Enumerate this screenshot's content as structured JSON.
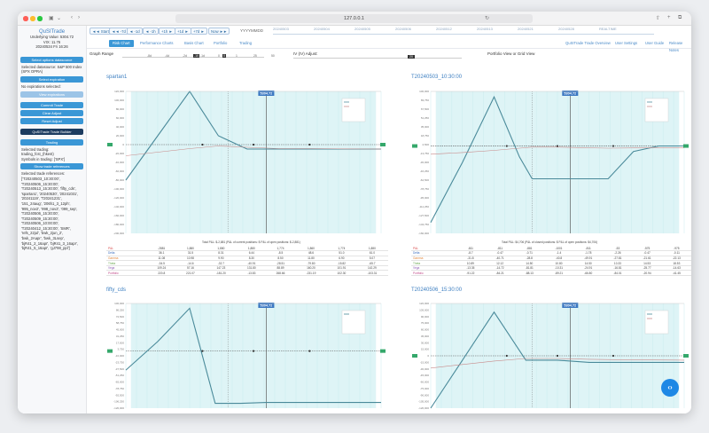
{
  "window": {
    "url": "127.0.0.1",
    "traffic_colors": [
      "#fe5f57",
      "#febc2e",
      "#28c840"
    ]
  },
  "sidebar": {
    "app_title": "QuSITrade",
    "underlying_label": "Underlying Value:",
    "underlying_value": "5304.72",
    "vix_label": "VIX:",
    "vix_value": "11.76",
    "date_label": "20240534 Fri",
    "time_value": "16:26",
    "btn_select_underlying": "Select options datasource",
    "selected_ds": "Selected datasource: S&P 500 Index (SPX OPRA)",
    "btn_select_expiration": "Select expiration",
    "no_expiration": "No expirations selected:",
    "btn_view_expiration": "View expirations",
    "btn_commit": "Commit Trade",
    "btn_clear": "Clear Adjust",
    "btn_reset": "Reset Adjust",
    "btn_builder": "QuSITrade Trade Builder",
    "trading_header": "Trading",
    "selected_trading": "Selected trading:",
    "trading_value": "trading_fcst_(hkest)",
    "symbols_label": "Symbols in trading: ['SPX']",
    "btn_show_refs": "Show trade references",
    "selected_refs_label": "Selected trade references:",
    "refs": [
      "['T20240503_10:30:00',",
      "'T20240506_15:30:00',",
      "'T20240513_15:30:00', 'fifty_cds',",
      "'spartan1', '20240530', '20241031',",
      "'20241119', 'T20241231',",
      "'151_24aug', '206h1_3_12ph',",
      "'995_nov2', '998_nov2', '099_sep',",
      "'T20240506_15:30:00',",
      "'T20240509_15:30:00',",
      "'T20240506_10:00:00',",
      "'T20240412_15:30:00', 'SMR',",
      "'refs_22jul', 'bwk_2jun_2',",
      "'bwk_2Aapr', 'bwk_3Lsep',",
      "'bjR41_2_16apr', 'bjR41_3_16apr',",
      "'bjR41_5_16apr', 'gJ798_ppl']"
    ]
  },
  "nav": {
    "buttons": [
      "◄◄ Start",
      "◄◄ -7d",
      "◄ -1d",
      "◄ -1h",
      "+1h ►",
      "+1d ►",
      "+7d ►",
      "Now ►►"
    ],
    "date_placeholder": "YYYYMMDD",
    "timeline": [
      "20240503",
      "20240504",
      "20240505",
      "20240506",
      "20240512",
      "20240513",
      "20240521",
      "20240528",
      "REALTIME"
    ]
  },
  "tabs": {
    "items": [
      "Risk Chart",
      "Performance Charts",
      "Basis Chart",
      "Portfolio",
      "Trading"
    ],
    "right_items": [
      "QuSITrade Trade Overview",
      "User Settings",
      "User Guide",
      "Release Notes"
    ]
  },
  "controls": {
    "graph_range_label": "Graph Range",
    "graph_ticks": [
      "-8d",
      "-4d",
      "-2d",
      "-1d",
      "0",
      "1",
      "25",
      "50"
    ],
    "graph_handles": [
      "-10",
      "0"
    ],
    "iv_label": "IV (IV) Adjust:",
    "iv_value": "20",
    "portfolio_label": "Portfolio View or Grid View"
  },
  "panels": [
    {
      "title": "spartan1",
      "price": "5304.72",
      "summary": "Total P&L: $-2,881 (P&L of current positions: $ P&L of open positions: $-2,881)"
    },
    {
      "title": "T20240503_10:30:00",
      "price": "5304.72",
      "summary": "Total P&L: $4,706 (P&L of closed positions: $ P&L of open positions: $4,706)"
    },
    {
      "title": "fifty_cds",
      "price": "5304.72"
    },
    {
      "title": "T20240506_15:30:00",
      "price": "5304.72"
    }
  ],
  "tables": {
    "left": {
      "labels": [
        "P&L",
        "Delta",
        "Gamma",
        "Theta",
        "Vega",
        "Portfolio"
      ],
      "rows": [
        [
          "-2881",
          "1,880",
          "1,880",
          "1,880",
          "1,774",
          "1,860",
          "1,774",
          "1,880"
        ],
        [
          "36.1",
          "31.5",
          "8.31",
          "6.44",
          "-8.5",
          "48.6",
          "51.0",
          "61.0"
        ],
        [
          "11.08",
          "10.98",
          "9.90",
          "8.30",
          "8.50",
          "11.80",
          "6.90",
          "5.07"
        ],
        [
          "-34.5",
          "-14.6",
          "-32.7",
          "-40.91",
          "-28.51",
          "-79.80",
          "-15.82",
          "-65.7"
        ],
        [
          "109.24",
          "57.16",
          "147.23",
          "131.80",
          "88.89",
          "160.20",
          "101.91",
          "142.29"
        ],
        [
          "220.8",
          "221.07",
          "-181.20",
          "-13.83",
          "268.66",
          "-231.19",
          "102.30",
          "-103.31"
        ]
      ]
    },
    "right": {
      "labels": [
        "P&L",
        "Delta",
        "Gamma",
        "Theta",
        "Vega",
        "Portfolio"
      ],
      "rows": [
        [
          "-811",
          "-811",
          "-881",
          "-1001",
          "-811",
          "-53",
          "-575",
          "-975"
        ],
        [
          "-8.7",
          "-0.47",
          "-0.71",
          "-1.4",
          "-1.78",
          "-2.26",
          "-0.47",
          "-0.11"
        ],
        [
          "-31.8",
          "-40.71",
          "-28.8",
          "-40.8",
          "-49.91",
          "-27.81",
          "-21.61",
          "-22.13"
        ],
        [
          "10.89",
          "12.12",
          "14.50",
          "10.80",
          "14.50",
          "10.33",
          "14.53",
          "18.53"
        ],
        [
          "-13.35",
          "-14.72",
          "-81.81",
          "-10.31",
          "-24.91",
          "-16.81",
          "-25.77",
          "-14.63"
        ],
        [
          "-91.22",
          "-84.21",
          "-88.13",
          "-89.21",
          "-66.80",
          "-84.01",
          "-20.94",
          "-41.45"
        ]
      ]
    }
  },
  "chart_data": [
    {
      "type": "line",
      "title": "spartan1",
      "x": [
        4400,
        4650,
        4900,
        5125,
        5350,
        5600,
        5850,
        6100,
        6400
      ],
      "y_ylim": [
        -200000,
        120000
      ],
      "ylim": [
        -200000,
        120000
      ],
      "series": [
        {
          "name": "Expiration",
          "values": [
            -80000,
            20000,
            120000,
            20000,
            -10000,
            -10000,
            -10000,
            -10000,
            -10000
          ]
        },
        {
          "name": "T+0",
          "values": [
            -25000,
            -17000,
            -9000,
            -3000,
            -6000,
            -9000,
            -9000,
            -9500,
            -10000
          ]
        }
      ]
    },
    {
      "type": "line",
      "title": "T20240503_10:30:00",
      "x": [
        4400,
        4650,
        4900,
        5100,
        5200,
        5400,
        5600,
        5800,
        6000,
        6200,
        6400
      ],
      "ylim": [
        -160000,
        100000
      ],
      "series": [
        {
          "name": "Expiration",
          "values": [
            -140000,
            -30000,
            90000,
            -20000,
            -60000,
            -60000,
            -60000,
            -60000,
            -10000,
            0,
            0
          ]
        },
        {
          "name": "T+0",
          "values": [
            -15000,
            -12000,
            -8000,
            -4000,
            -2000,
            -2000,
            -3000,
            -4000,
            -3500,
            -3000,
            -3000
          ]
        }
      ]
    },
    {
      "type": "line",
      "title": "fifty_cds",
      "x": [
        4400,
        4650,
        4900,
        5100,
        5300,
        5500,
        5800,
        6100,
        6400
      ],
      "ylim": [
        -120000,
        100000
      ],
      "series": [
        {
          "name": "Expiration",
          "values": [
            -40000,
            20000,
            90000,
            -110000,
            -110000,
            -108000,
            -108000,
            -108000,
            -108000
          ]
        }
      ]
    },
    {
      "type": "line",
      "title": "T20240506_15:30:00",
      "x": [
        4400,
        4650,
        4900,
        5150,
        5400,
        5650,
        5900,
        6150,
        6400
      ],
      "ylim": [
        -120000,
        120000
      ],
      "series": [
        {
          "name": "Expiration",
          "values": [
            -120000,
            -10000,
            100000,
            -10000,
            -10000,
            -15000,
            -15000,
            -15000,
            -15000
          ]
        },
        {
          "name": "T+0",
          "values": [
            -28000,
            -20000,
            -12000,
            -6000,
            -6000,
            -8000,
            -9000,
            -9500,
            -10000
          ]
        }
      ]
    }
  ]
}
